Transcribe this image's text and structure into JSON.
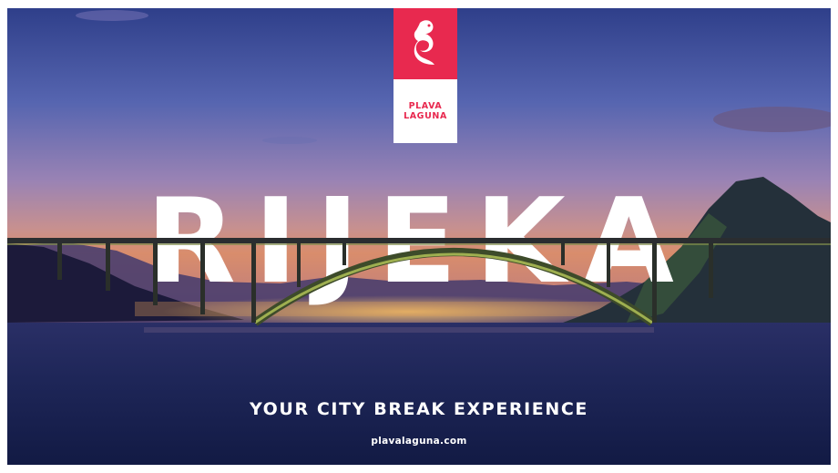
{
  "brand": {
    "name_line1": "PLAVA",
    "name_line2": "LAGUNA",
    "logo_icon": "goat-emblem-icon",
    "accent_color": "#e8294f"
  },
  "poster": {
    "city_title": "RIJEKA",
    "tagline": "YOUR CITY BREAK EXPERIENCE",
    "url": "plavalaguna.com"
  }
}
